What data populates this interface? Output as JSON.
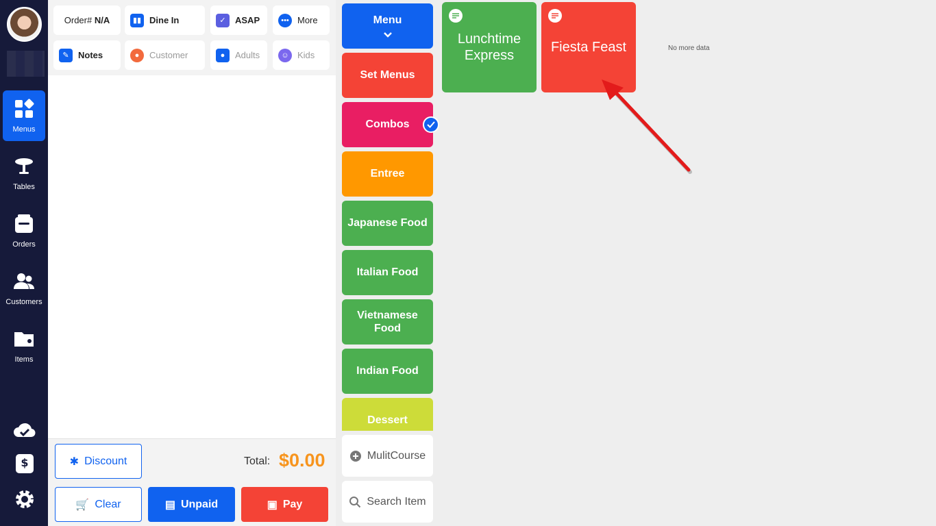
{
  "nav": {
    "items": [
      {
        "label": "Menus",
        "icon": "menus-icon"
      },
      {
        "label": "Tables",
        "icon": "table-icon"
      },
      {
        "label": "Orders",
        "icon": "orders-icon"
      },
      {
        "label": "Customers",
        "icon": "customers-icon"
      },
      {
        "label": "Items",
        "icon": "items-folder-icon"
      }
    ],
    "bottom_icons": [
      "cloud-check-icon",
      "cash-register-icon",
      "gear-icon"
    ]
  },
  "order": {
    "order_label": "Order#",
    "order_value": "N/A",
    "dine_in": "Dine In",
    "asap": "ASAP",
    "more": "More",
    "notes": "Notes",
    "customer": "Customer",
    "adults": "Adults",
    "kids": "Kids",
    "discount": "Discount",
    "total_label": "Total:",
    "total_value": "$0.00",
    "clear": "Clear",
    "unpaid": "Unpaid",
    "pay": "Pay"
  },
  "categories": [
    {
      "label": "Menu",
      "color": "#1062ef"
    },
    {
      "label": "Set Menus",
      "color": "#f44336"
    },
    {
      "label": "Combos",
      "color": "#e91e63"
    },
    {
      "label": "Entree",
      "color": "#ff9800"
    },
    {
      "label": "Japanese Food",
      "color": "#4caf50"
    },
    {
      "label": "Italian Food",
      "color": "#4caf50"
    },
    {
      "label": "Vietnamese Food",
      "color": "#4caf50"
    },
    {
      "label": "Indian Food",
      "color": "#4caf50"
    },
    {
      "label": "Dessert",
      "color": "#cddc39"
    }
  ],
  "utilities": {
    "multicourse": "MulitCourse",
    "search": "Search Item"
  },
  "items": [
    {
      "label": "Lunchtime Express",
      "color": "#4caf50"
    },
    {
      "label": "Fiesta Feast",
      "color": "#f44336"
    }
  ],
  "no_more": "No more data",
  "colors": {
    "nav_bg": "#161a3a",
    "primary": "#1062ef",
    "danger": "#f44336",
    "accent_total": "#f7941d"
  }
}
